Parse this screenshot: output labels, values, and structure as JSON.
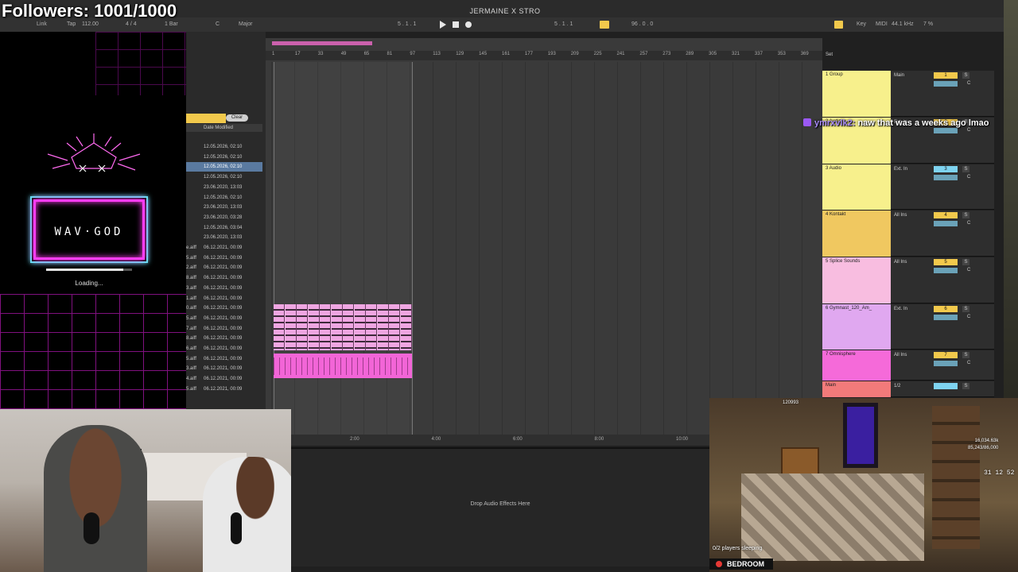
{
  "overlay": {
    "followers": "Followers: 1001/1000"
  },
  "transport": {
    "title": "JERMAINE X STRO",
    "link": "Link",
    "tap": "Tap",
    "tempo": "112.00",
    "signature": "4 / 4",
    "quantize": "1 Bar",
    "key_root": "C",
    "scale": "Major",
    "position": "5 . 1 . 1",
    "loop_start": "5 . 1 . 1",
    "loop_length": "96 . 0 . 0",
    "key_label": "Key",
    "midi_label": "MIDI",
    "sample_rate": "44.1 kHz",
    "cpu": "7 %"
  },
  "wav_overlay": {
    "logo": "WAV·GOD",
    "loading": "Loading...",
    "progress": 0.9
  },
  "browser": {
    "clear": "Clear",
    "column_header": "Date Modified",
    "rows": [
      {
        "name": "",
        "date": "12.05.2026, 02:10",
        "selected": false
      },
      {
        "name": "",
        "date": "12.05.2026, 02:10",
        "selected": false
      },
      {
        "name": "",
        "date": "12.05.2026, 02:10",
        "selected": true
      },
      {
        "name": "",
        "date": "12.05.2026, 02:10",
        "selected": false
      },
      {
        "name": "",
        "date": "23.06.2020, 13:03",
        "selected": false
      },
      {
        "name": "",
        "date": "12.05.2026, 02:10",
        "selected": false
      },
      {
        "name": "",
        "date": "23.06.2020, 13:03",
        "selected": false
      },
      {
        "name": "",
        "date": "23.06.2020, 03:28",
        "selected": false
      },
      {
        "name": "",
        "date": "12.05.2026, 03:04",
        "selected": false
      },
      {
        "name": "",
        "date": "23.06.2020, 13:03",
        "selected": false
      },
      {
        "name": "e.aiff",
        "date": "06.12.2021, 00:09",
        "selected": false
      },
      {
        "name": "5.aiff",
        "date": "06.12.2021, 00:09",
        "selected": false
      },
      {
        "name": "2.aiff",
        "date": "06.12.2021, 00:09",
        "selected": false
      },
      {
        "name": "8.aiff",
        "date": "06.12.2021, 00:09",
        "selected": false
      },
      {
        "name": "3.aiff",
        "date": "06.12.2021, 00:09",
        "selected": false
      },
      {
        "name": "1.aiff",
        "date": "06.12.2021, 00:09",
        "selected": false
      },
      {
        "name": "0.aiff",
        "date": "06.12.2021, 00:09",
        "selected": false
      },
      {
        "name": "5.aiff",
        "date": "06.12.2021, 00:09",
        "selected": false
      },
      {
        "name": "7.aiff",
        "date": "06.12.2021, 00:09",
        "selected": false
      },
      {
        "name": "8.aiff",
        "date": "06.12.2021, 00:09",
        "selected": false
      },
      {
        "name": "6.aiff",
        "date": "06.12.2021, 00:09",
        "selected": false
      },
      {
        "name": "5.aiff",
        "date": "06.12.2021, 00:09",
        "selected": false
      },
      {
        "name": "3.aiff",
        "date": "06.12.2021, 00:09",
        "selected": false
      },
      {
        "name": "4.aiff",
        "date": "06.12.2021, 00:09",
        "selected": false
      },
      {
        "name": "5.aiff",
        "date": "06.12.2021, 00:09",
        "selected": false
      }
    ]
  },
  "arrangement": {
    "bars": [
      "1",
      "17",
      "33",
      "49",
      "65",
      "81",
      "97",
      "113",
      "129",
      "145",
      "161",
      "177",
      "193",
      "209",
      "225",
      "241",
      "257",
      "273",
      "289",
      "305",
      "321",
      "337",
      "353",
      "369"
    ],
    "times": [
      "2:00",
      "4:00",
      "6:00",
      "8:00",
      "10:00"
    ],
    "set_label": "Set"
  },
  "tracks": [
    {
      "name": "1 Group",
      "color": "#f7f08c",
      "input": "Main",
      "number": "1",
      "numColor": "#f2c94c"
    },
    {
      "name": "2 Audio",
      "color": "#f7f08c",
      "input": "Ext. In",
      "number": "2",
      "numColor": "#f2c94c"
    },
    {
      "name": "3 Audio",
      "color": "#f7f08c",
      "input": "Ext. In",
      "number": "3",
      "numColor": "#7ed3f0"
    },
    {
      "name": "4 Kontakt",
      "color": "#f0c860",
      "input": "All Ins",
      "number": "4",
      "numColor": "#f2c94c"
    },
    {
      "name": "5 Splice Sounds",
      "color": "#f8bde0",
      "input": "All Ins",
      "number": "5",
      "numColor": "#f2c94c"
    },
    {
      "name": "6 Gymnast_120_Am_",
      "color": "#e0a8f0",
      "input": "Ext. In",
      "number": "6",
      "numColor": "#f2c94c"
    },
    {
      "name": "7 Omnisphere",
      "color": "#f56ad9",
      "input": "All Ins",
      "number": "7",
      "numColor": "#f2c94c"
    },
    {
      "name": "Main",
      "color": "#f27a7a",
      "input": "1/2",
      "number": "",
      "numColor": "#7ed3f0"
    }
  ],
  "chat": {
    "user": "ymrxvlk2:",
    "message": "naw that was a weeks ago lmao"
  },
  "devices": {
    "drop_hint": "Drop Audio Effects Here"
  },
  "minecraft": {
    "counter": "120993",
    "players_sleeping": "0/2 players sleeping",
    "room": "BEDROOM",
    "stat1": "16,034.63k",
    "stat2": "85,243/86,000",
    "time": "31 12 52"
  }
}
